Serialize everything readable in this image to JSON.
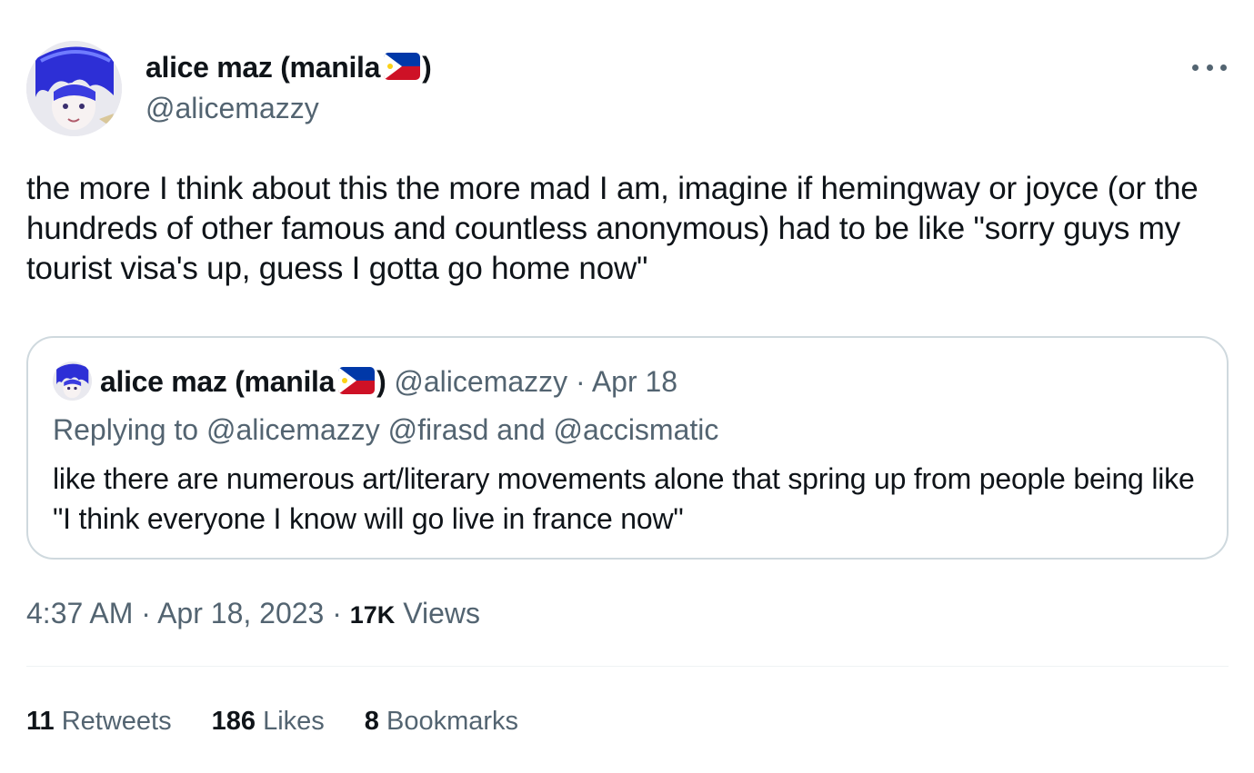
{
  "author": {
    "display_name": "alice maz (manila",
    "flag_emoji": "🇵🇭",
    "display_name_close": ")",
    "handle": "@alicemazzy"
  },
  "tweet": {
    "text": "the more I think about this the more mad I am, imagine if hemingway or joyce (or the hundreds of other famous and countless anonymous) had to be like \"sorry guys my tourist visa's up, guess I gotta go home now\""
  },
  "quote": {
    "display_name": "alice maz (manila",
    "display_name_close": ")",
    "handle": "@alicemazzy",
    "separator": " · ",
    "date": "Apr 18",
    "reply_prefix": "Replying to ",
    "reply_to": "@alicemazzy @firasd and @accismatic",
    "text": "like there are numerous art/literary movements alone that spring up from people being like \"I think everyone I know will go live in france now\""
  },
  "meta": {
    "time": "4:37 AM",
    "sep1": " · ",
    "date": "Apr 18, 2023",
    "sep2": " · ",
    "views_count": "17K",
    "views_label": " Views"
  },
  "stats": {
    "retweets_count": "11",
    "retweets_label": " Retweets",
    "likes_count": "186",
    "likes_label": " Likes",
    "bookmarks_count": "8",
    "bookmarks_label": " Bookmarks"
  },
  "colors": {
    "text_primary": "#0f1419",
    "text_secondary": "#536471",
    "border": "#cfd9de",
    "divider": "#eff3f4"
  },
  "icons": {
    "more": "more-dots-icon",
    "flag": "philippines-flag-icon"
  }
}
